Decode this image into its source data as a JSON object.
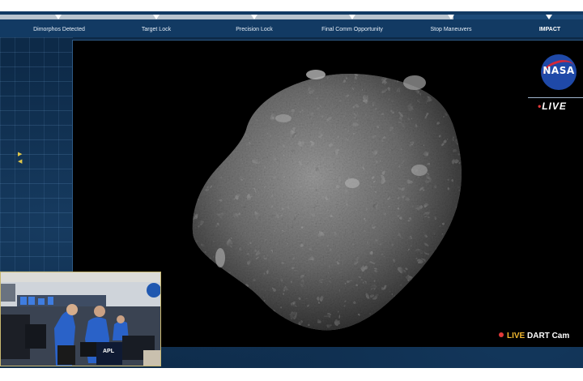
{
  "timeline": {
    "events": [
      {
        "label": "Dimorphos Detected"
      },
      {
        "label": "Target Lock"
      },
      {
        "label": "Precision Lock"
      },
      {
        "label": "Final Comm Opportunity"
      },
      {
        "label": "Stop Maneuvers"
      },
      {
        "label": "IMPACT"
      }
    ]
  },
  "branding": {
    "logo_text": "NASA",
    "live_badge_dot": "•",
    "live_badge": "LIVE"
  },
  "overlay": {
    "live_word": "LIVE",
    "feed_label": "DART Cam"
  },
  "inset": {
    "sign_text": "APL"
  },
  "colors": {
    "accent_live": "#f2b830",
    "rec_red": "#e23a3a",
    "banner_blue": "#123a63"
  }
}
